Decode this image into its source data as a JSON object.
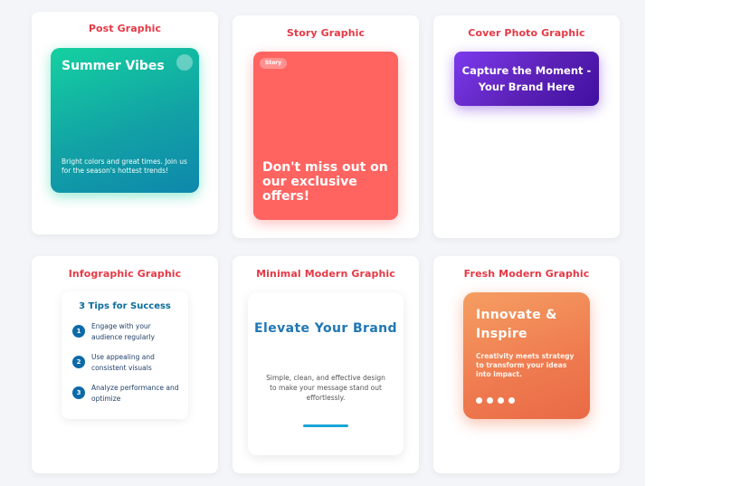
{
  "cards": {
    "post": {
      "title": "Post Graphic",
      "headline": "Summer Vibes",
      "body": "Bright colors and great times. Join us for the season's hottest trends!"
    },
    "story": {
      "title": "Story Graphic",
      "badge": "Story",
      "headline": "Don't miss out on our exclusive offers!"
    },
    "cover": {
      "title": "Cover Photo Graphic",
      "headline": "Capture the Moment - Your Brand Here"
    },
    "infographic": {
      "title": "Infographic Graphic",
      "heading": "3 Tips for Success",
      "tips": [
        {
          "num": "1",
          "text": "Engage with your audience regularly"
        },
        {
          "num": "2",
          "text": "Use appealing and consistent visuals"
        },
        {
          "num": "3",
          "text": "Analyze performance and optimize"
        }
      ]
    },
    "minimal": {
      "title": "Minimal Modern Graphic",
      "headline": "Elevate Your Brand",
      "body": "Simple, clean, and effective design to make your message stand out effortlessly."
    },
    "fresh": {
      "title": "Fresh Modern Graphic",
      "headline": "Innovate & Inspire",
      "body": "Creativity meets strategy to transform your ideas into impact."
    }
  },
  "colors": {
    "title_red": "#e63946",
    "post_gradient_start": "#14d1a0",
    "post_gradient_end": "#0e87ac",
    "story_coral": "#ff6461",
    "cover_purple": "#6d28d9",
    "info_blue": "#0d6aa8",
    "minimal_blue": "#1f77b4",
    "fresh_orange": "#ef7a4f"
  }
}
